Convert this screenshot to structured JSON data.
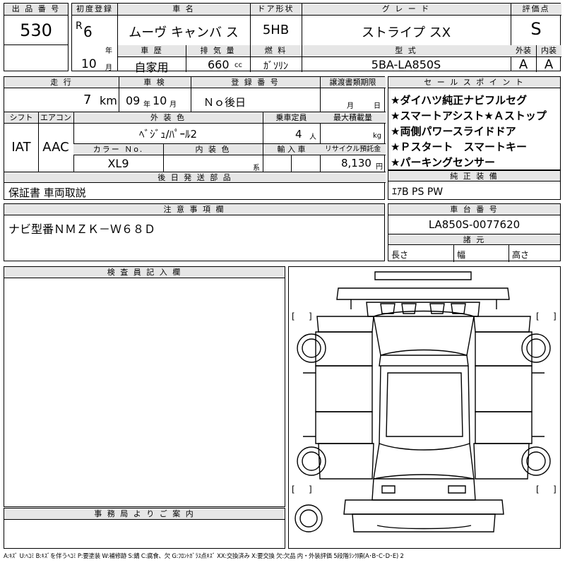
{
  "lot": {
    "label": "出 品 番 号",
    "value": "530"
  },
  "first_reg": {
    "label": "初度登録",
    "era": "R",
    "year": "6",
    "year_unit": "年",
    "month": "10",
    "month_unit": "月"
  },
  "car_name": {
    "label": "車 名",
    "value": "ムーヴ キャンバ ス"
  },
  "door": {
    "label": "ドア形状",
    "value": "5HB"
  },
  "grade": {
    "label": "グ レ ー ド",
    "value": "ストライプ スX"
  },
  "score": {
    "label": "評価点",
    "value": "S"
  },
  "history": {
    "label": "車 歴",
    "value": "自家用"
  },
  "displacement": {
    "label": "排 気 量",
    "value": "660",
    "unit": "cc"
  },
  "fuel": {
    "label": "燃 料",
    "value": "ｶﾞｿﾘﾝ"
  },
  "model": {
    "label": "型 式",
    "value": "5BA-LA850S"
  },
  "exterior_score": {
    "label": "外装",
    "value": "A"
  },
  "interior_score": {
    "label": "内装",
    "value": "A"
  },
  "mileage": {
    "label": "走 行",
    "value": "7",
    "unit": "km"
  },
  "inspection": {
    "label": "車 検",
    "year": "09",
    "year_unit": "年",
    "month": "10",
    "month_unit": "月"
  },
  "reg_no": {
    "label": "登 録 番 号",
    "value": "Ｎｏ後日"
  },
  "transfer_docs": {
    "label": "譲渡書類期限",
    "month_unit": "月",
    "day_unit": "日"
  },
  "shift": {
    "label": "シフト",
    "value": "IAT"
  },
  "aircon": {
    "label": "エアコン",
    "value": "AAC"
  },
  "ext_color": {
    "label": "外 装 色",
    "value": "ﾍﾞｼﾞｭ/ﾊﾟｰﾙ2"
  },
  "capacity": {
    "label": "乗車定員",
    "value": "4",
    "unit": "人"
  },
  "max_load": {
    "label": "最大積載量",
    "unit": "kg"
  },
  "color_no": {
    "label": "カラー Ｎo.",
    "value": "XL9"
  },
  "int_color": {
    "label": "内 装 色",
    "unit": "系"
  },
  "import": {
    "label": "輸 入 車"
  },
  "recycle": {
    "label": "リサイクル預託金",
    "value": "8,130",
    "unit": "円"
  },
  "later_parts": {
    "label": "後 日 発 送 部 品",
    "value": "保証書 車両取説"
  },
  "notes": {
    "label": "注 意 事 項 欄",
    "value": "ナビ型番ＮＭＺＫ－Ｗ６８Ｄ"
  },
  "sales_points": {
    "label": "セ ー ル ス ポ イ ン ト",
    "items": [
      "★ダイハツ純正ナビフルセグ",
      "★スマートアシスト★Ａストップ",
      "★両側パワースライドドア",
      "★Ｐスタート　スマートキー",
      "★パーキングセンサー"
    ]
  },
  "std_equipment": {
    "label": "純 正 装 備",
    "value": "ｴｱB PS PW"
  },
  "chassis": {
    "label": "車 台 番 号",
    "value": "LA850S-0077620"
  },
  "specs": {
    "label": "諸 元",
    "length": "長さ",
    "width": "幅",
    "height": "高さ"
  },
  "inspector": {
    "label": "検 査 員 記 入 欄"
  },
  "office": {
    "label": "事 務 局 よ り ご 案 内"
  },
  "legend": "A:ｷｽﾞ U:ﾍｺﾐ B:ｷｽﾞを伴うﾍｺﾐ P:要塗装 W:補修跡 S:錆 C:腐食、欠 G:ﾌﾛﾝﾄｶﾞﾗｽ点ｷｽﾞ XX:交換済み X:要交換 欠:欠品 内・外装評価 5段階ﾗﾝｸ順(A･B･C･D･E) 2",
  "diagram": {
    "brackets": [
      "[",
      "]",
      "[",
      "]",
      "[",
      "]",
      "[",
      "]"
    ]
  }
}
